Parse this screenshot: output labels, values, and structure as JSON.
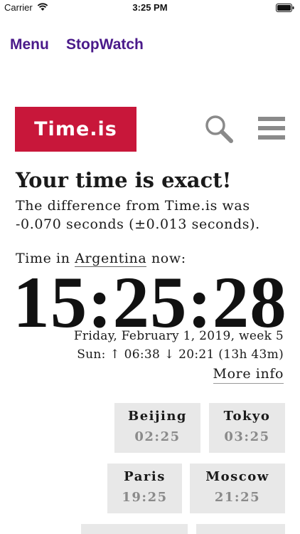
{
  "status_bar": {
    "carrier": "Carrier",
    "time": "3:25 PM",
    "icons": [
      "wifi-icon",
      "battery-icon"
    ]
  },
  "nav": {
    "menu": "Menu",
    "stopwatch": "StopWatch"
  },
  "header": {
    "logo": "Time.is",
    "icons": [
      "search-icon",
      "hamburger-menu-icon"
    ],
    "brand_color": "#c8173a"
  },
  "main": {
    "headline": "Your time is exact!",
    "difference": "The difference from Time.is was -0.070 seconds (±0.013 seconds).",
    "time_in_prefix": "Time in ",
    "location": "Argentina",
    "time_in_suffix": " now:",
    "clock": "15:25:28",
    "date": "Friday, February 1, 2019, week 5",
    "sun": "Sun: ↑ 06:38 ↓ 20:21 (13h 43m)",
    "more_info": "More info"
  },
  "cities": [
    {
      "name": "Beijing",
      "time": "02:25"
    },
    {
      "name": "Tokyo",
      "time": "03:25"
    },
    {
      "name": "Paris",
      "time": "19:25"
    },
    {
      "name": "Moscow",
      "time": "21:25"
    }
  ]
}
